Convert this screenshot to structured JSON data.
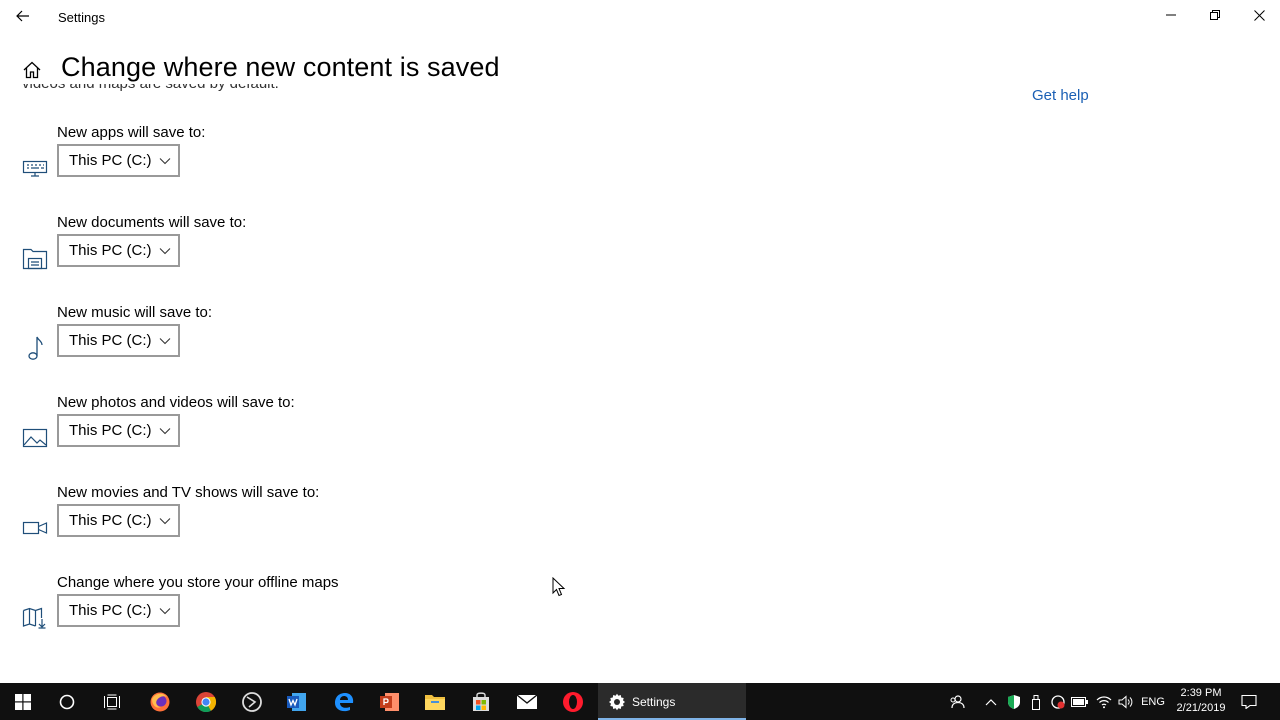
{
  "window": {
    "app_title": "Settings",
    "controls": [
      "minimize",
      "restore",
      "close"
    ]
  },
  "header": {
    "title": "Change where new content is saved"
  },
  "description_partial": "videos and maps are saved by default.",
  "help_link": "Get help",
  "settings": [
    {
      "label": "New apps will save to:",
      "value": "This PC (C:)",
      "icon": "apps-icon"
    },
    {
      "label": "New documents will save to:",
      "value": "This PC (C:)",
      "icon": "documents-icon"
    },
    {
      "label": "New music will save to:",
      "value": "This PC (C:)",
      "icon": "music-icon"
    },
    {
      "label": "New photos and videos will save to:",
      "value": "This PC (C:)",
      "icon": "photos-icon"
    },
    {
      "label": "New movies and TV shows will save to:",
      "value": "This PC (C:)",
      "icon": "video-icon"
    },
    {
      "label": "Change where you store your offline maps",
      "value": "This PC (C:)",
      "icon": "maps-icon"
    }
  ],
  "taskbar": {
    "apps": [
      "start-icon",
      "cortana-icon",
      "task-view-icon",
      "firefox-icon",
      "chrome-icon",
      "app-circle-icon",
      "word-icon",
      "edge-icon",
      "powerpoint-icon",
      "file-explorer-icon",
      "store-icon",
      "mail-icon",
      "opera-icon"
    ],
    "active_app_label": "Settings",
    "tray": {
      "language": "ENG",
      "time": "2:39 PM",
      "date": "2/21/2019"
    }
  },
  "colors": {
    "accent_link": "#1a5fb4",
    "taskbar_bg": "#101010",
    "active_underline": "#7fb3e6"
  }
}
